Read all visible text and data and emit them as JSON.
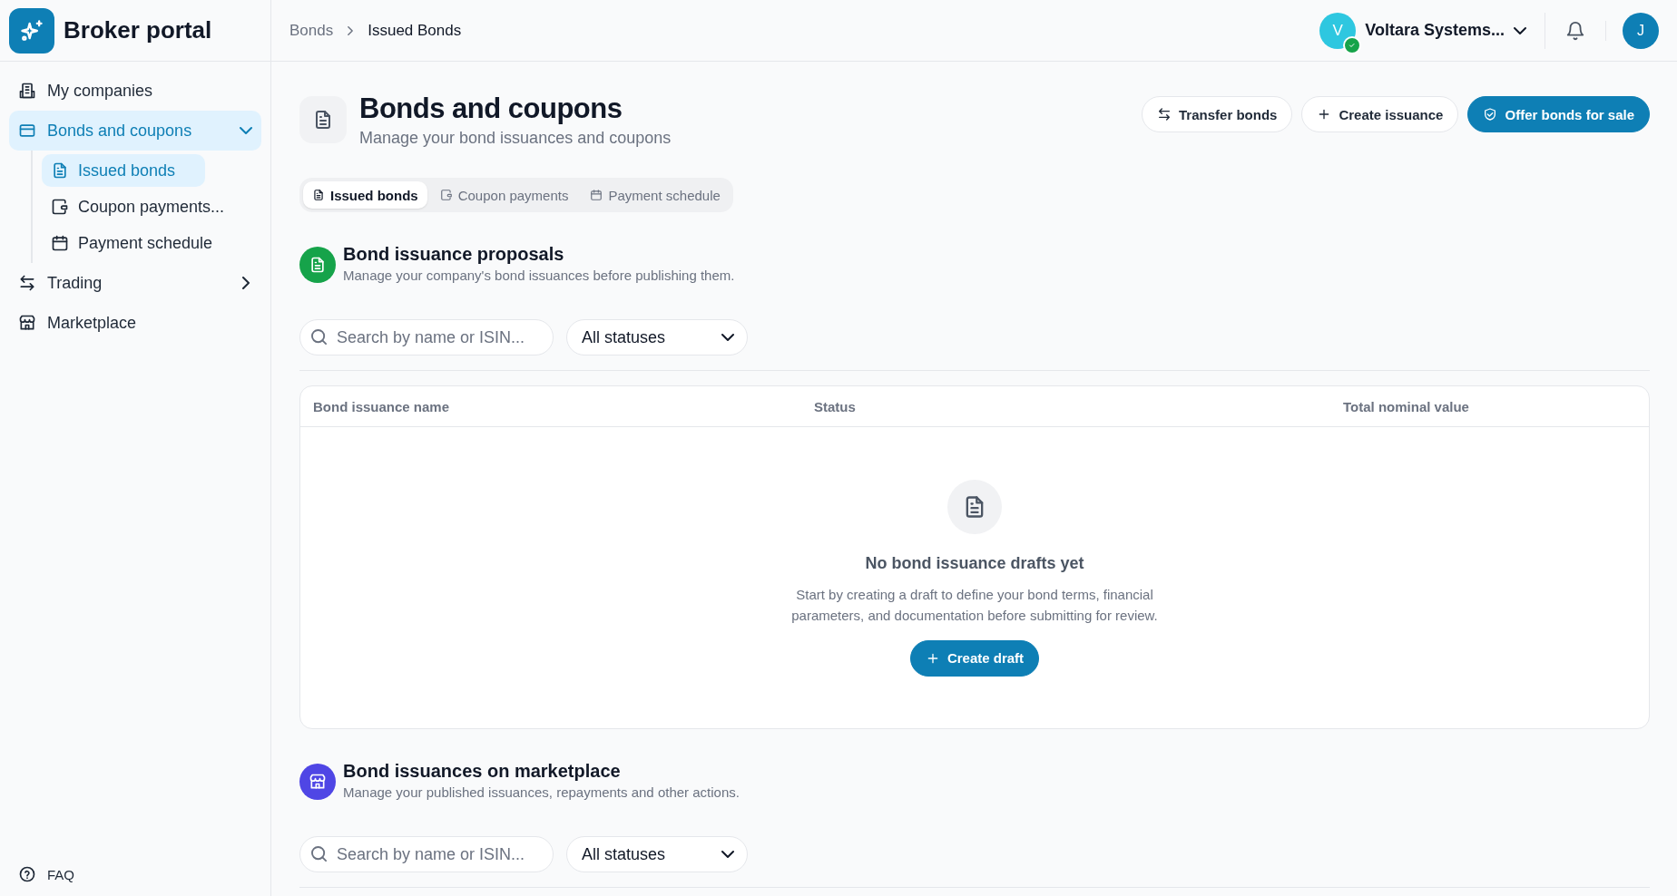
{
  "sidebar": {
    "app_name": "Broker portal",
    "items": [
      {
        "label": "My companies",
        "kind": "link",
        "selected": false
      },
      {
        "label": "Bonds and coupons",
        "kind": "group",
        "selected": true,
        "expanded": true,
        "children": [
          {
            "label": "Issued bonds",
            "selected": true
          },
          {
            "label": "Coupon payments...",
            "selected": false
          },
          {
            "label": "Payment schedule",
            "selected": false
          }
        ]
      },
      {
        "label": "Trading",
        "kind": "group",
        "selected": false,
        "expanded": false
      },
      {
        "label": "Marketplace",
        "kind": "link",
        "selected": false
      }
    ],
    "footer_link": "FAQ"
  },
  "header": {
    "breadcrumbs": [
      "Bonds",
      "Issued Bonds"
    ],
    "company": {
      "initial": "V",
      "name": "Voltara Systems...",
      "verified": true
    },
    "user_initial": "J"
  },
  "page": {
    "title": "Bonds and coupons",
    "subtitle": "Manage your bond issuances and coupons",
    "actions": [
      {
        "label": "Transfer bonds",
        "kind": "outline"
      },
      {
        "label": "Create issuance",
        "kind": "outline"
      },
      {
        "label": "Offer bonds for sale",
        "kind": "primary"
      }
    ],
    "tabs": [
      {
        "label": "Issued bonds",
        "selected": true
      },
      {
        "label": "Coupon payments",
        "selected": false
      },
      {
        "label": "Payment schedule",
        "selected": false
      }
    ],
    "sections": [
      {
        "title": "Bond issuance proposals",
        "subtitle": "Manage your company's bond issuances before publishing them.",
        "color": "#16a34a",
        "search_placeholder": "Search by name or ISIN...",
        "status_filter": "All statuses",
        "table": {
          "columns": [
            "Bond issuance name",
            "Status",
            "Total nominal value"
          ],
          "empty_state": {
            "title": "No bond issuance drafts yet",
            "text": "Start by creating a draft to define your bond terms, financial parameters, and documentation before submitting for review.",
            "button": "Create draft"
          }
        }
      },
      {
        "title": "Bond issuances on marketplace",
        "subtitle": "Manage your published issuances, repayments and other actions.",
        "color": "#4f46e5",
        "search_placeholder": "Search by name or ISIN...",
        "status_filter": "All statuses"
      }
    ]
  }
}
